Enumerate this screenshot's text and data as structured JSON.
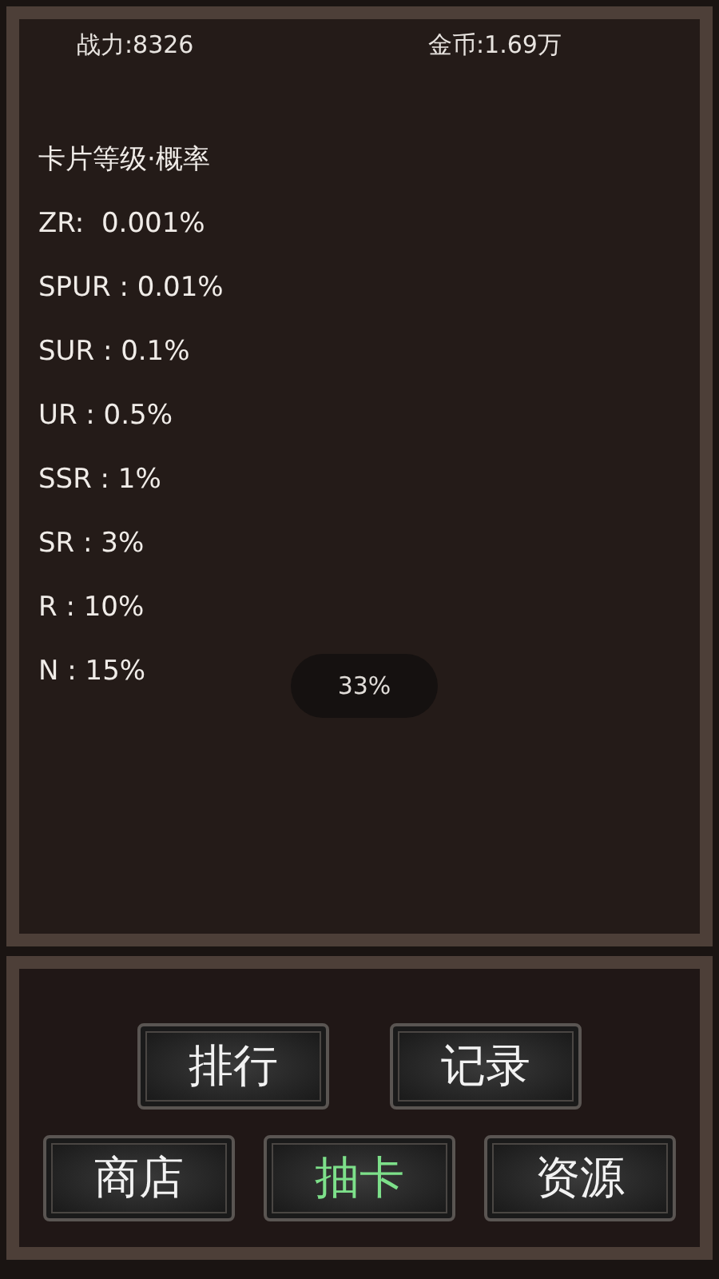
{
  "header": {
    "power": "战力:8326",
    "gold": "金币:1.69万"
  },
  "rates": {
    "title": "卡片等级·概率",
    "items": [
      "ZR:  0.001%",
      "SPUR : 0.01%",
      "SUR : 0.1%",
      "UR : 0.5%",
      "SSR : 1%",
      "SR : 3%",
      "R : 10%",
      "N : 15%"
    ]
  },
  "toast": "33%",
  "nav": [
    [
      {
        "label": "排行",
        "selected": false
      },
      {
        "label": "记录",
        "selected": false
      }
    ],
    [
      {
        "label": "商店",
        "selected": false
      },
      {
        "label": "抽卡",
        "selected": true
      },
      {
        "label": "资源",
        "selected": false
      }
    ]
  ]
}
